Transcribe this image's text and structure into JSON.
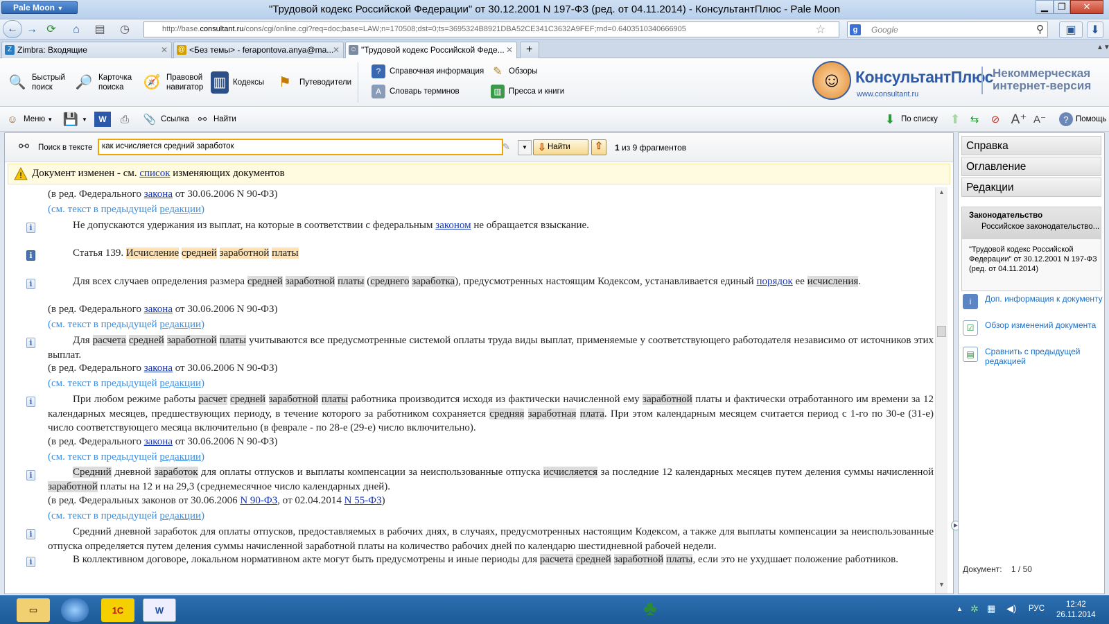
{
  "titlebar": {
    "app_button": "Pale Moon",
    "title": "\"Трудовой кодекс Российской Федерации\" от 30.12.2001 N 197-ФЗ (ред. от 04.11.2014) - КонсультантПлюс - Pale Moon"
  },
  "navbar": {
    "url_prefix": "http://base.",
    "url_domain": "consultant.ru",
    "url_rest": "/cons/cgi/online.cgi?req=doc;base=LAW;n=170508;dst=0;ts=3695324B8921DBA52CE341C3632A9FEF;rnd=0.6403510340666905",
    "search_placeholder": "Google"
  },
  "tabs": [
    {
      "label": "Zimbra: Входящие",
      "icon": "zimbra-icon",
      "icon_color": "#2a7bc0"
    },
    {
      "label": "<Без темы> - ferapontova.anya@ma...",
      "icon": "mail-icon",
      "icon_color": "#d0a000"
    },
    {
      "label": "\"Трудовой кодекс Российской Феде...",
      "icon": "consultant-icon",
      "icon_color": "#7a8aa0"
    }
  ],
  "ribbon": {
    "buttons": [
      {
        "label1": "Быстрый",
        "label2": "поиск"
      },
      {
        "label1": "Карточка",
        "label2": "поиска"
      },
      {
        "label1": "Правовой",
        "label2": "навигатор"
      },
      {
        "label1": "Кодексы",
        "label2": ""
      },
      {
        "label1": "Путеводители",
        "label2": ""
      }
    ],
    "small": [
      "Справочная информация",
      "Словарь терминов",
      "Обзоры",
      "Пресса и книги"
    ],
    "brand": "КонсультантПлюс",
    "brand_url": "www.consultant.ru",
    "brand_note1": "Некоммерческая",
    "brand_note2": "интернет-версия"
  },
  "toolbar": {
    "menu": "Меню",
    "link": "Ссылка",
    "find": "Найти",
    "by_list": "По списку",
    "help": "Помощь"
  },
  "search": {
    "label": "Поиск в тексте",
    "value": "как исчисляется средний заработок",
    "button": "Найти",
    "result_current": "1",
    "result_text": "из 9 фрагментов"
  },
  "notice": {
    "before": "Документ изменен - см. ",
    "link": "список",
    "after": " изменяющих документов"
  },
  "doc": {
    "red_fed": "(в ред. Федерального ",
    "law_link": "закона",
    "red_date": " от 30.06.2006 N 90-ФЗ)",
    "prev_text": "(см. текст в предыдущей ",
    "prev_link": "редакции",
    "prev_close": ")",
    "p1_a": "Не допускаются удержания из выплат, на которые в соответствии с федеральным ",
    "p1_link": "законом",
    "p1_b": " не обращается взыскание.",
    "art_num": "Статья 139. ",
    "art_w1": "Исчисление",
    "art_w2": "средней",
    "art_w3": "заработной",
    "art_w4": "платы",
    "p2_a": "Для всех случаев определения размера ",
    "p2_b": " (",
    "p2_c": "), предусмотренных настоящим Кодексом, устанавливается единый ",
    "p2_link": "порядок",
    "p2_d": " ее ",
    "w_srednej": "средней",
    "w_zarabotnoj": "заработной",
    "w_platy": "платы",
    "w_srednego": "среднего",
    "w_zarabotka": "заработка",
    "w_ischisleniya": "исчисления",
    "w_rascheta": "расчета",
    "w_raschet": "расчет",
    "w_srednyaya": "средняя",
    "w_zarabotnaya": "заработная",
    "w_plata": "плата",
    "w_srednij": "Средний",
    "w_zarabotok": "заработок",
    "w_ischislyaetsya": "исчисляется",
    "p3_a": "Для ",
    "p3_b": " учитываются все предусмотренные системой оплаты труда виды выплат, применяемые у соответствующего работодателя независимо от источников этих выплат.",
    "p4_a": "При любом режиме работы ",
    "p4_b": " работника производится исходя из фактически начисленной ему ",
    "p4_c": " платы и фактически отработанного им времени за 12 календарных месяцев, предшествующих периоду, в течение которого за работником сохраняется ",
    "p4_d": ". При этом календарным месяцем считается период с 1-го по 30-е (31-е) число соответствующего месяца включительно (в феврале - по 28-е (29-е) число включительно).",
    "p5_a": " дневной ",
    "p5_b": " для оплаты отпусков и выплаты компенсации за неиспользованные отпуска ",
    "p5_c": " за последние 12 календарных месяцев путем деления суммы начисленной ",
    "p5_d": " платы на 12 и на 29,3 (среднемесячное число календарных дней).",
    "red_feds": "(в ред. Федеральных законов от 30.06.2006 ",
    "law1": "N 90-ФЗ",
    "red_mid": ", от 02.04.2014 ",
    "law2": "N 55-ФЗ",
    "red_end": ")",
    "p6": "Средний дневной заработок для оплаты отпусков, предоставляемых в рабочих днях, в случаях, предусмотренных настоящим Кодексом, а также для выплаты компенсации за неиспользованные отпуска определяется путем деления суммы начисленной заработной платы на количество рабочих дней по календарю шестидневной рабочей недели.",
    "p7_a": "В коллективном договоре, локальном нормативном акте могут быть предусмотрены и иные периоды для ",
    "p7_b": ", если это не ухудшает положение работников.",
    "info_marker": "i"
  },
  "rpanel": {
    "buttons": [
      "Справка",
      "Оглавление",
      "Редакции"
    ],
    "leg_title": "Законодательство",
    "leg_sub": "Российское законодательство...",
    "leg_doc": "\"Трудовой кодекс Российской Федерации\" от 30.12.2001 N 197-ФЗ (ред. от 04.11.2014)",
    "links": [
      "Доп. информация к документу",
      "Обзор изменений документа",
      "Сравнить с предыдущей редакцией"
    ],
    "doc_label": "Документ:",
    "doc_pos": "1 / 50"
  },
  "taskbar": {
    "lang": "РУС",
    "time": "12:42",
    "date": "26.11.2014"
  }
}
